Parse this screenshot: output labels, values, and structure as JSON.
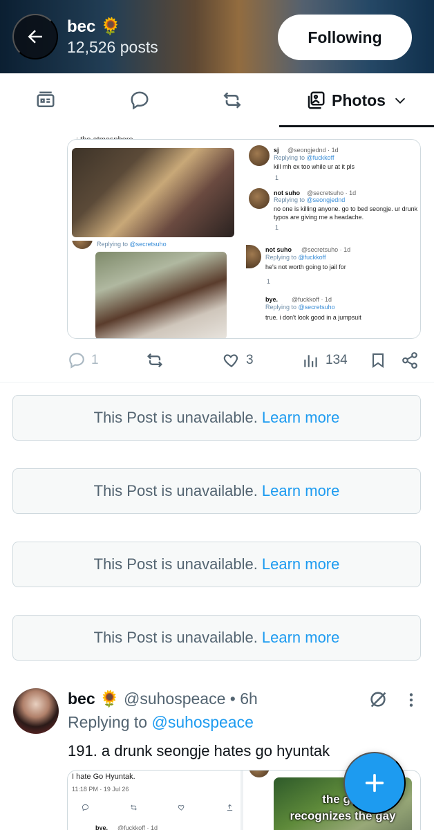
{
  "header": {
    "name": "bec 🌻",
    "post_count": "12,526 posts",
    "follow_label": "Following"
  },
  "tabs": {
    "active_label": "Photos"
  },
  "post1": {
    "cut_text": ": the atmosphere",
    "panel_tl": {},
    "panel_tr": {
      "tweet1": {
        "name": "sj",
        "handle": "@seongjednd · 1d",
        "reply": "Replying to ",
        "reply_to": "@fuckkoff",
        "text": "kill mh ex too while ur at it pls",
        "likes": "1"
      },
      "tweet2": {
        "name": "not suho",
        "handle": "@secretsuho · 1d",
        "reply": "Replying to ",
        "reply_to": "@seongjednd",
        "text": "no one is killing anyone. go to bed seongje. ur drunk typos are giving me a headache.",
        "likes": "1"
      }
    },
    "panel_bl": {
      "reply": "Replying to ",
      "reply_to": "@secretsuho"
    },
    "panel_br": {
      "tweet1": {
        "name": "not suho",
        "handle": "@secretsuho · 1d",
        "reply": "Replying to ",
        "reply_to": "@fuckkoff",
        "text": "he's not worth going to jail for",
        "likes": "1"
      },
      "tweet2": {
        "name": "bye.",
        "handle": "@fuckkoff · 1d",
        "reply": "Replying to ",
        "reply_to": "@secretsuho",
        "text": "true. i don't look good in a jumpsuit"
      }
    },
    "actions": {
      "replies": "1",
      "likes": "3",
      "views": "134"
    }
  },
  "unavailable": [
    {
      "text": "This Post is unavailable.",
      "link": "Learn more"
    },
    {
      "text": "This Post is unavailable.",
      "link": "Learn more"
    },
    {
      "text": "This Post is unavailable.",
      "link": "Learn more"
    },
    {
      "text": "This Post is unavailable.",
      "link": "Learn more"
    }
  ],
  "post2": {
    "name": "bec 🌻",
    "handle_time": "@suhospeace • 6h",
    "reply_prefix": "Replying to ",
    "reply_to": "@suhospeace",
    "text": "191. a drunk seongje hates go hyuntak",
    "left_panel": {
      "text": "I hate Go Hyuntak.",
      "time": "11:18 PM · 19 Jul 26",
      "name": "bye.",
      "handle": "@fuckkoff · 1d"
    },
    "right_panel": {
      "caption1": "the gay",
      "caption2": "recognizes the gay"
    }
  },
  "colors": {
    "accent": "#1d9bf0",
    "text": "#0f1419",
    "muted": "#536471"
  }
}
